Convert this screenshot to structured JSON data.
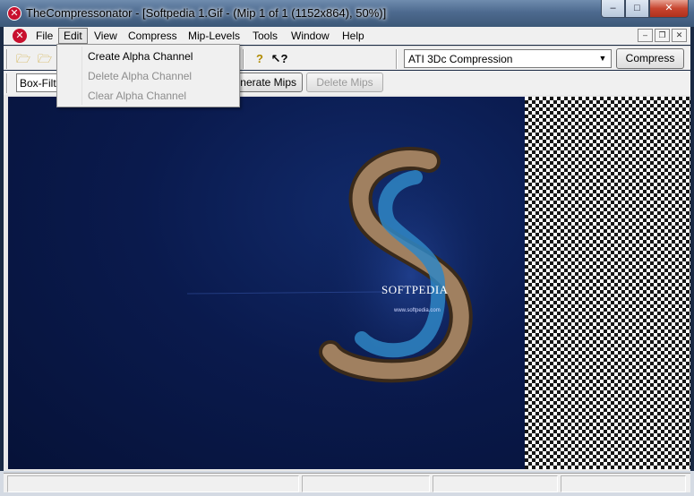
{
  "window": {
    "title": "TheCompressonator - [Softpedia 1.Gif - (Mip 1 of 1 (1152x864), 50%)]",
    "app_icon": "compressonator-logo-icon",
    "minimize_glyph": "–",
    "maximize_glyph": "□",
    "close_glyph": "✕"
  },
  "menubar": {
    "items": [
      "File",
      "Edit",
      "View",
      "Compress",
      "Mip-Levels",
      "Tools",
      "Window",
      "Help"
    ],
    "active": "Edit",
    "mdi_minimize": "–",
    "mdi_restore": "❐",
    "mdi_close": "✕"
  },
  "edit_menu": {
    "items": [
      {
        "label": "Create Alpha Channel",
        "enabled": true
      },
      {
        "label": "Delete Alpha Channel",
        "enabled": false
      },
      {
        "label": "Clear Alpha Channel",
        "enabled": false
      }
    ]
  },
  "toolbar": {
    "compression_format": "ATI 3Dc Compression",
    "compress_label": "Compress",
    "filter_value": "Box-Filter",
    "generate_mips_label": "Generate Mips",
    "delete_mips_label": "Delete Mips",
    "help_glyph": "?",
    "context_help_glyph": "?"
  },
  "image": {
    "logo_text": "SOFTPEDIA",
    "logo_url": "www.softpedia.com"
  },
  "colors": {
    "titlebar": "#4d6a8f",
    "image_background": "#0a1a4d",
    "close_button": "#c7452f"
  }
}
